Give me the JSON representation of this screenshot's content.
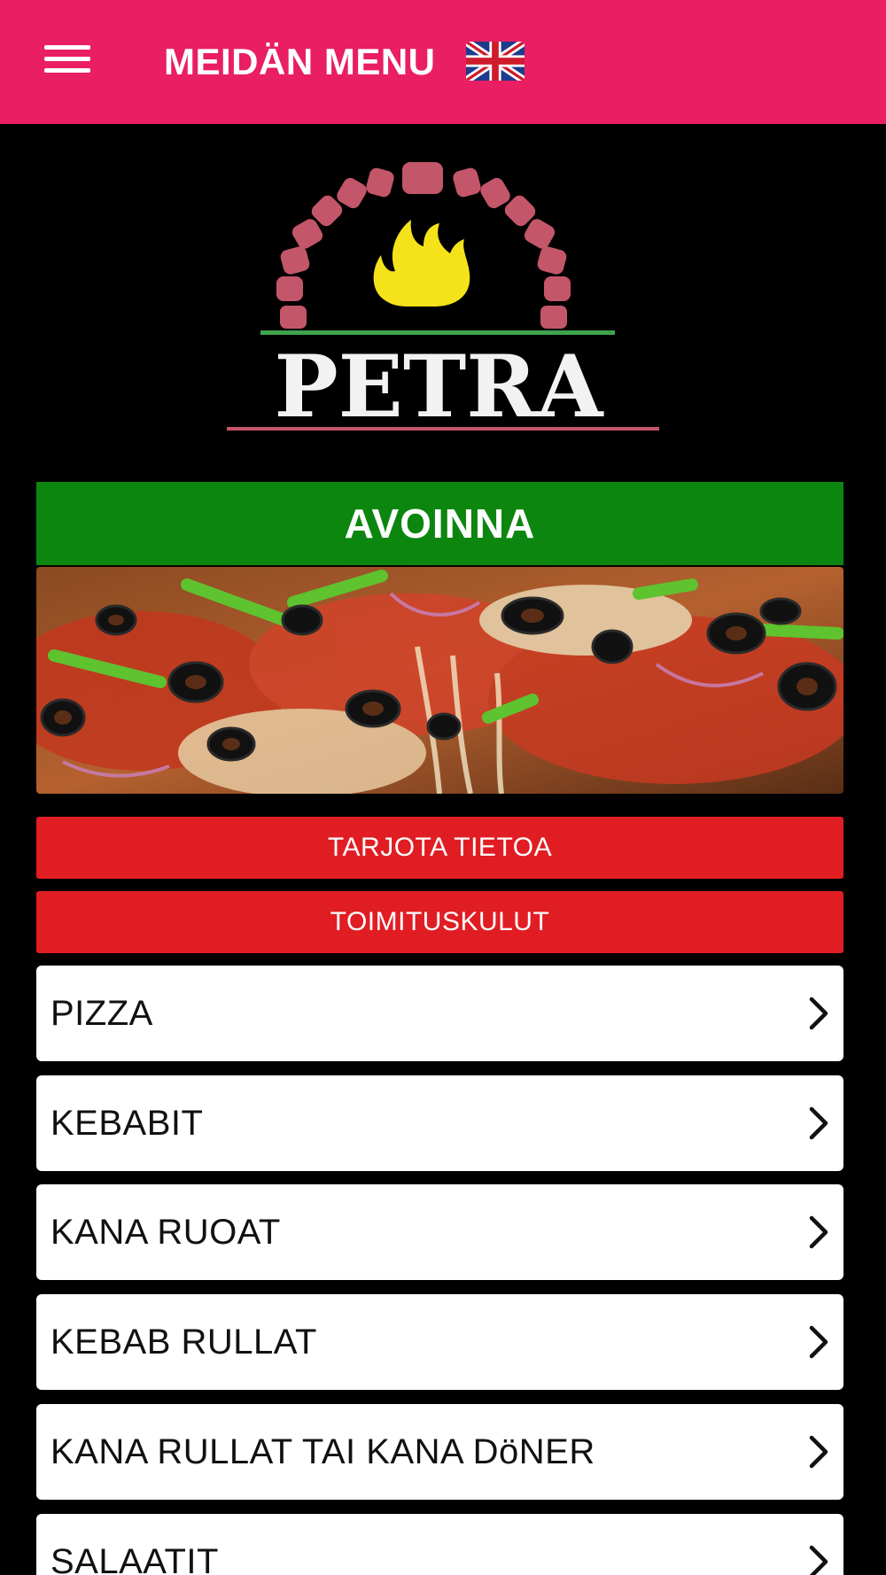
{
  "header": {
    "title": "MEIDÄN MENU",
    "menu_icon": "hamburger-menu-icon",
    "language_flag": "uk-flag-icon",
    "background_color": "#e91e63"
  },
  "logo": {
    "text": "PETRA",
    "icon": "oven-flame-logo"
  },
  "status": {
    "label": "AVOINNA",
    "color": "#0c860f"
  },
  "banner": {
    "image": "pizza-banner-image"
  },
  "buttons": [
    {
      "label": "TARJOTA TIETOA"
    },
    {
      "label": "TOIMITUSKULUT"
    }
  ],
  "categories": [
    {
      "label": "PIZZA"
    },
    {
      "label": "KEBABIT"
    },
    {
      "label": "KANA RUOAT"
    },
    {
      "label": "KEBAB RULLAT"
    },
    {
      "label": "KANA RULLAT TAI KANA DöNER"
    },
    {
      "label": "SALAATIT"
    }
  ],
  "colors": {
    "button_red": "#e11d24",
    "page_background": "#000000"
  }
}
